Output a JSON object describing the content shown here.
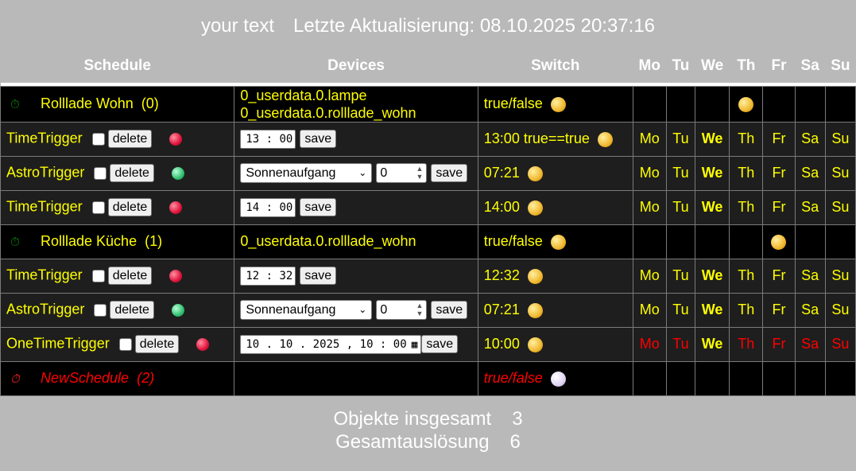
{
  "header": {
    "text": "your text",
    "update_label": "Letzte Aktualisierung:",
    "update_value": "08.10.2025 20:37:16"
  },
  "columns": {
    "schedule": "Schedule",
    "devices": "Devices",
    "switch": "Switch",
    "days": [
      "Mo",
      "Tu",
      "We",
      "Th",
      "Fr",
      "Sa",
      "Su"
    ]
  },
  "buttons": {
    "delete": "delete",
    "save": "save"
  },
  "rows": [
    {
      "name": "Rolllade Wohn",
      "count": "(0)",
      "device1": "0_userdata.0.lampe",
      "device2": "0_userdata.0.rolllade_wohn",
      "switch": "true/false"
    },
    {
      "trigger": "TimeTrigger",
      "time": "13 : 00",
      "switch": "13:00  true==true"
    },
    {
      "trigger": "AstroTrigger",
      "astro": "Sonnenaufgang",
      "offset": "0",
      "switch": "07:21"
    },
    {
      "trigger": "TimeTrigger",
      "time": "14 : 00",
      "switch": "14:00"
    },
    {
      "name": "Rolllade Küche",
      "count": "(1)",
      "device1": "0_userdata.0.rolllade_wohn",
      "switch": "true/false"
    },
    {
      "trigger": "TimeTrigger",
      "time": "12 : 32",
      "switch": "12:32"
    },
    {
      "trigger": "AstroTrigger",
      "astro": "Sonnenaufgang",
      "offset": "0",
      "switch": "07:21"
    },
    {
      "trigger": "OneTimeTrigger",
      "datetime": "10 . 10 . 2025 ,  10 : 00",
      "switch": "10:00"
    },
    {
      "name": "NewSchedule",
      "count": "(2)",
      "switch": "true/false"
    }
  ],
  "footer": {
    "total_label": "Objekte insgesamt",
    "total_value": "3",
    "trig_label": "Gesamtauslösung",
    "trig_value": "6"
  },
  "colors": {
    "text": "#ffff00",
    "inactive": "#ff0000",
    "header_bg": "#b9b9b9"
  }
}
